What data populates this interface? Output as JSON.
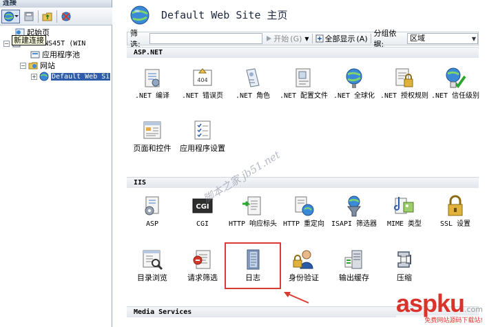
{
  "left": {
    "header": "连接",
    "tooltip": "新建连接",
    "tree": [
      {
        "label": "起始页"
      },
      {
        "label": "WS-TONS45T (WIN"
      },
      {
        "label": "应用程序池"
      },
      {
        "label": "网站"
      },
      {
        "label": "Default Web Si"
      }
    ]
  },
  "header": {
    "title": "Default Web Site 主页"
  },
  "filter": {
    "label": "筛选:",
    "start": "开始",
    "start_key": "(G)",
    "show_all": "全部显示",
    "show_all_key": "(A)",
    "group_by": "分组依据:",
    "group_value": "区域"
  },
  "sections": {
    "aspnet": "ASP.NET",
    "iis": "IIS",
    "media": "Media Services"
  },
  "aspnet_items": [
    {
      "label": ".NET 编译"
    },
    {
      "label": ".NET 错误页"
    },
    {
      "label": ".NET 角色"
    },
    {
      "label": ".NET 配置文件"
    },
    {
      "label": ".NET 全球化"
    },
    {
      "label": ".NET 授权规则"
    },
    {
      "label": ".NET 信任级别"
    },
    {
      "label": "页面和控件"
    },
    {
      "label": "应用程序设置"
    }
  ],
  "iis_items": [
    {
      "label": "ASP"
    },
    {
      "label": "CGI"
    },
    {
      "label": "HTTP 响应标头"
    },
    {
      "label": "HTTP 重定向"
    },
    {
      "label": "ISAPI 筛选器"
    },
    {
      "label": "MIME 类型"
    },
    {
      "label": "SSL 设置"
    },
    {
      "label": "目录浏览"
    },
    {
      "label": "请求筛选"
    },
    {
      "label": "日志"
    },
    {
      "label": "身份验证"
    },
    {
      "label": "输出缓存"
    },
    {
      "label": "压缩"
    }
  ],
  "overlay": {
    "watermark": "脚本之家 jb51.net",
    "brand_main": "aspku",
    "brand_tld": ".com",
    "brand_sub": "免费网站源码下载站!"
  },
  "colors": {
    "selection": "#2f5ca8",
    "highlight": "#d93b33",
    "brand": "#d9342b"
  }
}
